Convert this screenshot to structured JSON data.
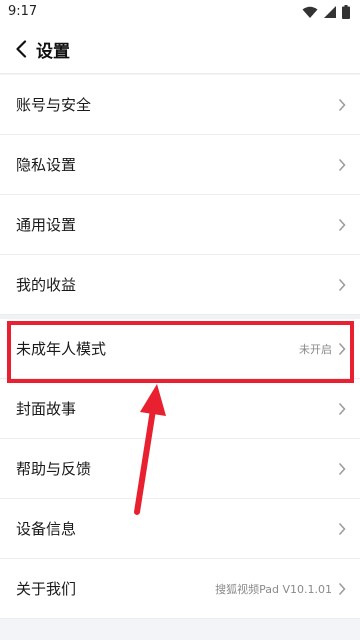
{
  "status_bar": {
    "time": "9:17"
  },
  "header": {
    "title": "设置"
  },
  "settings_group_1": [
    {
      "label": "账号与安全"
    },
    {
      "label": "隐私设置"
    },
    {
      "label": "通用设置"
    },
    {
      "label": "我的收益"
    }
  ],
  "settings_group_2": [
    {
      "label": "未成年人模式",
      "value": "未开启"
    },
    {
      "label": "封面故事"
    },
    {
      "label": "帮助与反馈"
    },
    {
      "label": "设备信息"
    },
    {
      "label": "关于我们",
      "value": "搜狐视频Pad V10.1.01"
    }
  ],
  "annotation": {
    "highlight_color": "#e8202f"
  }
}
